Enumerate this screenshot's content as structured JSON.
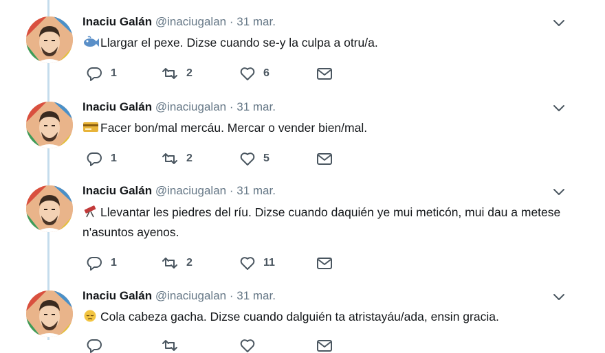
{
  "tweets": [
    {
      "name": "Inaciu Galán",
      "handle": "@inaciugalan",
      "separator": "·",
      "date": "31 mar.",
      "emoji": "fish-icon",
      "text": "Llargar el pexe. Dizse cuando se-y la culpa a otru/a.",
      "replies": "1",
      "retweets": "2",
      "likes": "6"
    },
    {
      "name": "Inaciu Galán",
      "handle": "@inaciugalan",
      "separator": "·",
      "date": "31 mar.",
      "emoji": "credit-card-icon",
      "text": "Facer bon/mal mercáu. Mercar o vender bien/mal.",
      "replies": "1",
      "retweets": "2",
      "likes": "5"
    },
    {
      "name": "Inaciu Galán",
      "handle": "@inaciugalan",
      "separator": "·",
      "date": "31 mar.",
      "emoji": "telescope-icon",
      "text": "Llevantar les piedres del ríu. Dizse cuando daquién ye mui meticón, mui dau a metese n'asuntos ayenos.",
      "replies": "1",
      "retweets": "2",
      "likes": "11"
    },
    {
      "name": "Inaciu Galán",
      "handle": "@inaciugalan",
      "separator": "·",
      "date": "31 mar.",
      "emoji": "pensive-face-icon",
      "text": "Cola cabeza gacha. Dizse cuando dalguién ta atristayáu/ada, ensin gracia."
    }
  ],
  "colors": {
    "thread_line": "#c4dcec",
    "icon_gray": "#4a5660",
    "secondary_text": "#657786"
  }
}
